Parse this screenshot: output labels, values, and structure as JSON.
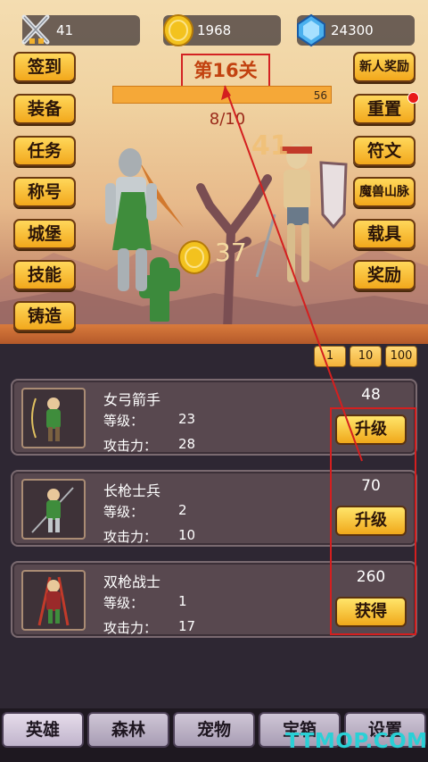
{
  "stats": {
    "sword": "41",
    "gold": "1968",
    "gem": "24300"
  },
  "left_buttons": [
    "签到",
    "装备",
    "任务",
    "称号",
    "城堡",
    "技能",
    "铸造"
  ],
  "right_buttons": [
    "新人奖励",
    "重置",
    "符文",
    "魔兽山脉",
    "载具",
    "奖励"
  ],
  "level": {
    "title": "第16关",
    "progress_value": "56",
    "progress_fraction": 1.0,
    "wave": "8/10",
    "damage_float": "41",
    "coin_float": "37"
  },
  "multipliers": [
    "1",
    "10",
    "100"
  ],
  "heroes": [
    {
      "name": "女弓箭手",
      "level_label": "等级：",
      "level": "23",
      "attack_label": "攻击力：",
      "attack": "28",
      "cost": "48",
      "button": "升级"
    },
    {
      "name": "长枪士兵",
      "level_label": "等级：",
      "level": "2",
      "attack_label": "攻击力：",
      "attack": "10",
      "cost": "70",
      "button": "升级"
    },
    {
      "name": "双枪战士",
      "level_label": "等级：",
      "level": "1",
      "attack_label": "攻击力：",
      "attack": "17",
      "cost": "260",
      "button": "获得"
    }
  ],
  "tabs": [
    "英雄",
    "森林",
    "宠物",
    "宝箱",
    "设置"
  ],
  "watermark": "TTMOP.COM",
  "colors": {
    "button_gold": "#f2a81c",
    "highlight_red": "#d41f1f",
    "panel_bg": "#2e2733"
  },
  "icons": {
    "sword": "crossed-swords-icon",
    "gold": "gold-coin-icon",
    "gem": "blue-gem-icon"
  }
}
